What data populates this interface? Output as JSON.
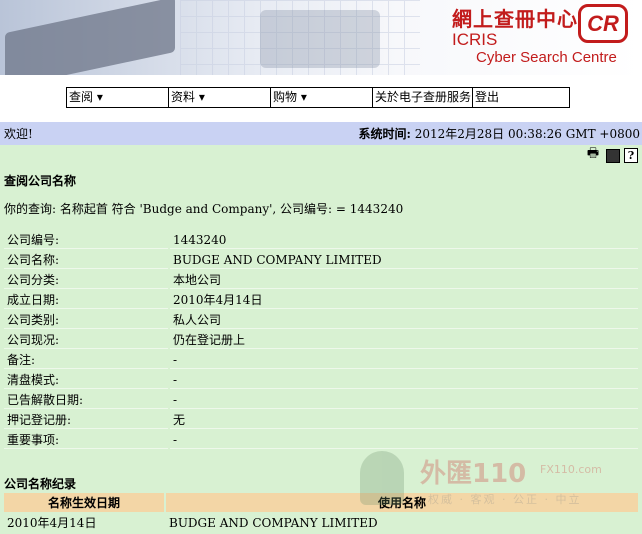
{
  "banner": {
    "cn_title": "網上查冊中心",
    "icris": "ICRIS",
    "cyber": "Cyber Search Centre",
    "logo": "CR"
  },
  "menu": [
    {
      "label": "查阅 ▾"
    },
    {
      "label": "资料 ▾"
    },
    {
      "label": "购物 ▾"
    },
    {
      "label": "关於电子查册服务"
    },
    {
      "label": "登出"
    }
  ],
  "welcome": {
    "text": "欢迎!",
    "time_label": "系统时间:",
    "time_value": " 2012年2月28日 00:38:26 GMT +0800"
  },
  "toolbar": {
    "print_icon": "🖶",
    "save_icon": "💾",
    "help_icon": "?"
  },
  "page": {
    "title": "查阅公司名称",
    "query": "你的查询: 名称起首 符合 'Budge and Company', 公司编号: = 1443240"
  },
  "company": {
    "rows": [
      {
        "label": "公司编号:",
        "value": "1443240"
      },
      {
        "label": "公司名称:",
        "value": "BUDGE AND COMPANY LIMITED"
      },
      {
        "label": "公司分类:",
        "value": "本地公司"
      },
      {
        "label": "成立日期:",
        "value": "2010年4月14日"
      },
      {
        "label": "公司类别:",
        "value": "私人公司"
      },
      {
        "label": "公司现况:",
        "value": "仍在登记册上"
      },
      {
        "label": "备注:",
        "value": "-"
      },
      {
        "label": "清盘模式:",
        "value": "-"
      },
      {
        "label": "已告解散日期:",
        "value": "-"
      },
      {
        "label": "押记登记册:",
        "value": "无"
      },
      {
        "label": "重要事项:",
        "value": "-"
      }
    ]
  },
  "history": {
    "title": "公司名称纪录",
    "headers": [
      "名称生效日期",
      "使用名称"
    ],
    "rows": [
      {
        "date": "2010年4月14日",
        "name": "BUDGE AND COMPANY LIMITED"
      }
    ]
  },
  "watermark": {
    "big": "外匯110",
    "small": "FX110.com",
    "tag": "权威 · 客观 · 公正 · 中立"
  }
}
